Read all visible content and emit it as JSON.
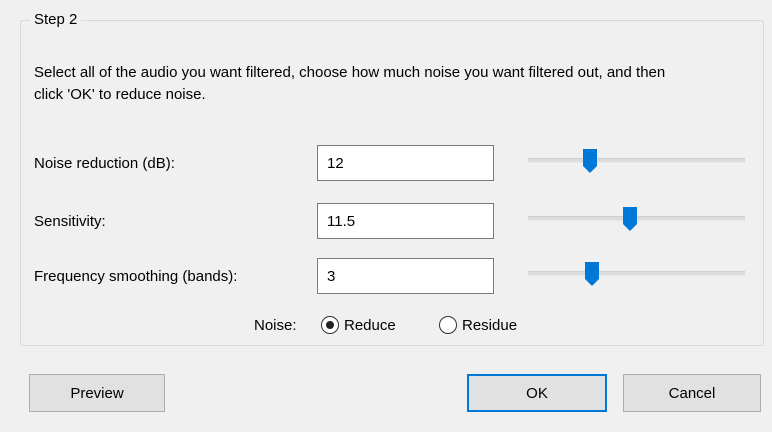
{
  "step_group": {
    "title": "Step 2",
    "instructions": "Select all of the audio you want filtered, choose how much noise you want filtered out, and then click 'OK' to reduce noise."
  },
  "settings": {
    "noise_reduction": {
      "label": "Noise reduction (dB):",
      "value": "12",
      "slider_fraction": 0.27
    },
    "sensitivity": {
      "label": "Sensitivity:",
      "value": "11.5",
      "slider_fraction": 0.47
    },
    "frequency_smoothing": {
      "label": "Frequency smoothing (bands):",
      "value": "3",
      "slider_fraction": 0.28
    }
  },
  "noise": {
    "label": "Noise:",
    "options": [
      {
        "label": "Reduce",
        "selected": true
      },
      {
        "label": "Residue",
        "selected": false
      }
    ]
  },
  "buttons": {
    "preview": "Preview",
    "ok": "OK",
    "cancel": "Cancel"
  },
  "colors": {
    "accent": "#0078d7",
    "background": "#f0f0f0"
  }
}
